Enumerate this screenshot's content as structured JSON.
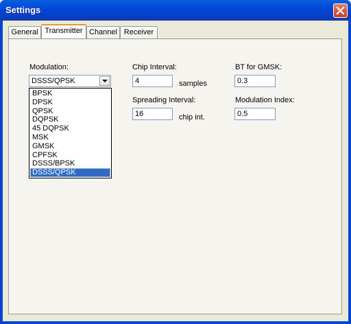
{
  "window": {
    "title": "Settings"
  },
  "tabs": [
    {
      "label": "General"
    },
    {
      "label": "Transmitter"
    },
    {
      "label": "Channel"
    },
    {
      "label": "Receiver"
    }
  ],
  "active_tab": "Transmitter",
  "modulation": {
    "label": "Modulation:",
    "selected": "DSSS/QPSK",
    "options": [
      "BPSK",
      "DPSK",
      "QPSK",
      "DQPSK",
      "45 DQPSK",
      "MSK",
      "GMSK",
      "CPFSK",
      "DSSS/BPSK",
      "DSSS/QPSK"
    ]
  },
  "chip_interval": {
    "label": "Chip Interval:",
    "value": "4",
    "unit": "samples"
  },
  "spreading_interval": {
    "label": "Spreading Interval:",
    "value": "16",
    "unit": "chip int."
  },
  "bt_gmsk": {
    "label": "BT for GMSK:",
    "value": "0.3"
  },
  "modulation_index": {
    "label": "Modulation Index:",
    "value": "0.5"
  },
  "colors": {
    "title_bar": "#0046d5",
    "selection": "#316ac5",
    "dialog_bg": "#ece9d8",
    "active_tab_accent": "#e69a28"
  },
  "icons": {
    "close": "close-icon",
    "dropdown": "chevron-down-icon"
  }
}
